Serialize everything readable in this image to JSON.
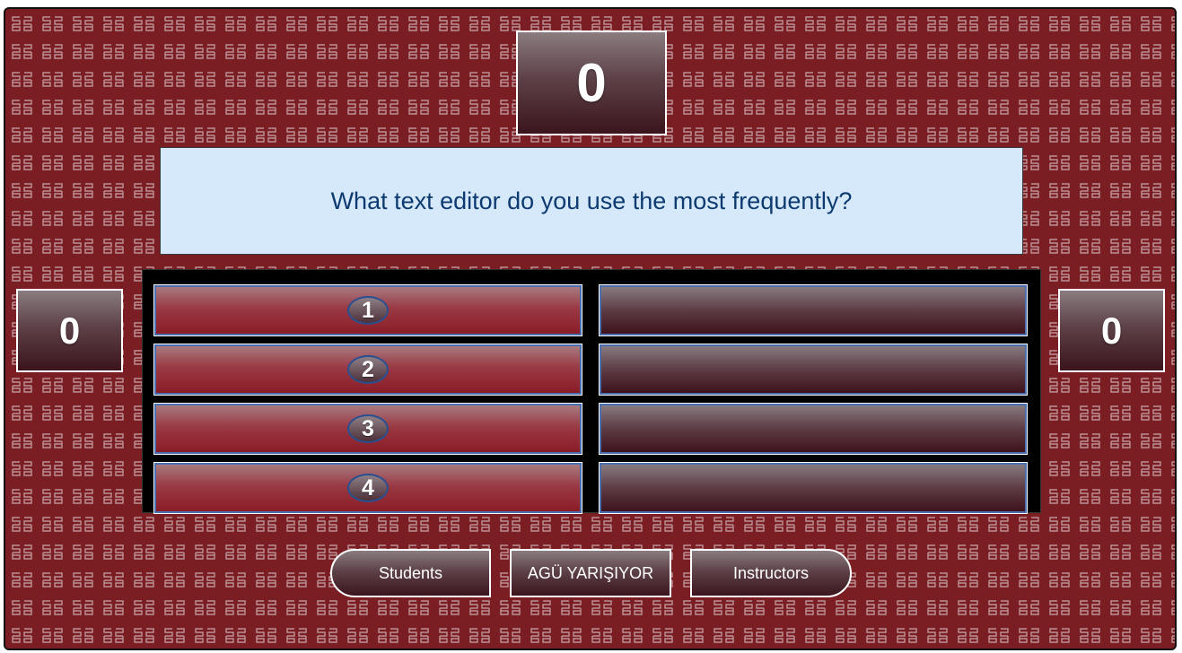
{
  "scores": {
    "round": "0",
    "team_left": "0",
    "team_right": "0"
  },
  "question": "What text editor do you use the most frequently?",
  "answers": [
    {
      "number": "1",
      "text": ""
    },
    {
      "number": "2",
      "text": ""
    },
    {
      "number": "3",
      "text": ""
    },
    {
      "number": "4",
      "text": ""
    }
  ],
  "buttons": {
    "students": "Students",
    "center": "AGÜ YARIŞIYOR",
    "instructors": "Instructors"
  },
  "colors": {
    "background": "#7a1e24",
    "question_bg": "#d6e9fb",
    "question_text": "#0d3a70"
  }
}
